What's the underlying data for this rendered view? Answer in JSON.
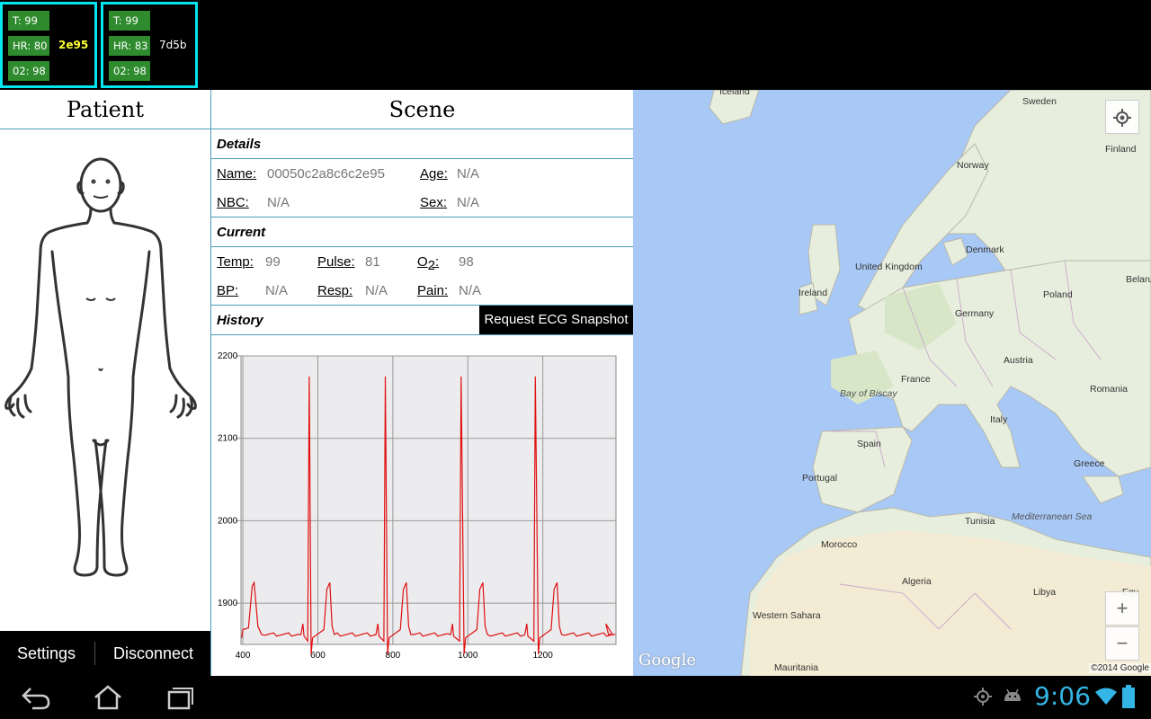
{
  "patients": [
    {
      "temp": "T: 99",
      "hr": "HR: 80",
      "o2": "02: 98",
      "id": "2e95",
      "id_color": "#ffff33"
    },
    {
      "temp": "T: 99",
      "hr": "HR: 83",
      "o2": "02: 98",
      "id": "7d5b",
      "id_color": "#ffffff"
    }
  ],
  "patient_panel": {
    "title": "Patient"
  },
  "bottom": {
    "settings": "Settings",
    "disconnect": "Disconnect"
  },
  "scene": {
    "title": "Scene",
    "details": {
      "heading": "Details",
      "name_label": "Name:",
      "name_value": "00050c2a8c6c2e95",
      "age_label": "Age:",
      "age_value": "N/A",
      "nbc_label": "NBC:",
      "nbc_value": "N/A",
      "sex_label": "Sex:",
      "sex_value": "N/A"
    },
    "current": {
      "heading": "Current",
      "temp_label": "Temp:",
      "temp_value": "99",
      "pulse_label": "Pulse:",
      "pulse_value": "81",
      "o2_label_main": "O",
      "o2_label_sub": "2",
      "o2_label_colon": ":",
      "o2_value": "98",
      "bp_label": "BP:",
      "bp_value": "N/A",
      "resp_label": "Resp:",
      "resp_value": "N/A",
      "pain_label": "Pain:",
      "pain_value": "N/A"
    },
    "history": {
      "heading": "History",
      "ecg_button": "Request ECG Snapshot"
    }
  },
  "chart_data": {
    "type": "line",
    "xlim": [
      395,
      1395
    ],
    "ylim": [
      1850,
      2200
    ],
    "xticks": [
      400,
      600,
      800,
      1000,
      1200
    ],
    "yticks": [
      1900,
      2000,
      2100,
      2200
    ],
    "grid": true,
    "series": [
      {
        "color": "#e01010",
        "baseline": 1862,
        "beats": [
          {
            "q": 563,
            "r": 577,
            "s": 582,
            "t": 632
          },
          {
            "q": 763,
            "r": 780,
            "s": 786,
            "t": 836
          },
          {
            "q": 962,
            "r": 982,
            "s": 990,
            "t": 1040
          },
          {
            "q": 1160,
            "r": 1180,
            "s": 1188,
            "t": 1238
          }
        ],
        "r_peak": 2175,
        "t_peak": 1925,
        "p_peak": 1875,
        "s_trough": 1838,
        "start_t": {
          "x": 430,
          "y": 1925
        }
      }
    ]
  },
  "map": {
    "labels": [
      "Iceland",
      "Sweden",
      "Finland",
      "Norway",
      "Denmark",
      "United Kingdom",
      "Ireland",
      "Poland",
      "Belarus",
      "Germany",
      "Austria",
      "France",
      "Bay of Biscay",
      "Romania",
      "Italy",
      "Spain",
      "Portugal",
      "Greece",
      "Tunisia",
      "Mediterranean Sea",
      "Morocco",
      "Algeria",
      "Libya",
      "Western Sahara",
      "Mauritania",
      "Egy"
    ],
    "attribution": "©2014 Google",
    "logo": "Google",
    "zoom_in": "+",
    "zoom_out": "−"
  },
  "status": {
    "time": "9:06"
  }
}
